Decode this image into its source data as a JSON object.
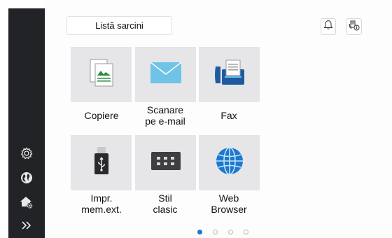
{
  "header": {
    "job_list_label": "Listă sarcini"
  },
  "apps": [
    {
      "label_line1": "Copiere",
      "label_line2": "",
      "icon": "copy-icon"
    },
    {
      "label_line1": "Scanare",
      "label_line2": "pe e-mail",
      "icon": "envelope-icon"
    },
    {
      "label_line1": "Fax",
      "label_line2": "",
      "icon": "fax-icon"
    },
    {
      "label_line1": "Impr.",
      "label_line2": "mem.ext.",
      "icon": "usb-drive-icon"
    },
    {
      "label_line1": "Stil",
      "label_line2": "clasic",
      "icon": "keypad-icon"
    },
    {
      "label_line1": "Web",
      "label_line2": "Browser",
      "icon": "globe-icon"
    }
  ],
  "sidebar": {
    "icons": [
      "settings-gear-icon",
      "language-globe-icon",
      "home-settings-icon",
      "expand-chevrons-icon"
    ]
  },
  "pager": {
    "pages": 4,
    "current": 1
  },
  "colors": {
    "sidebar": "#222326",
    "tile": "#e6e6e8",
    "accent": "#1e77cc"
  }
}
